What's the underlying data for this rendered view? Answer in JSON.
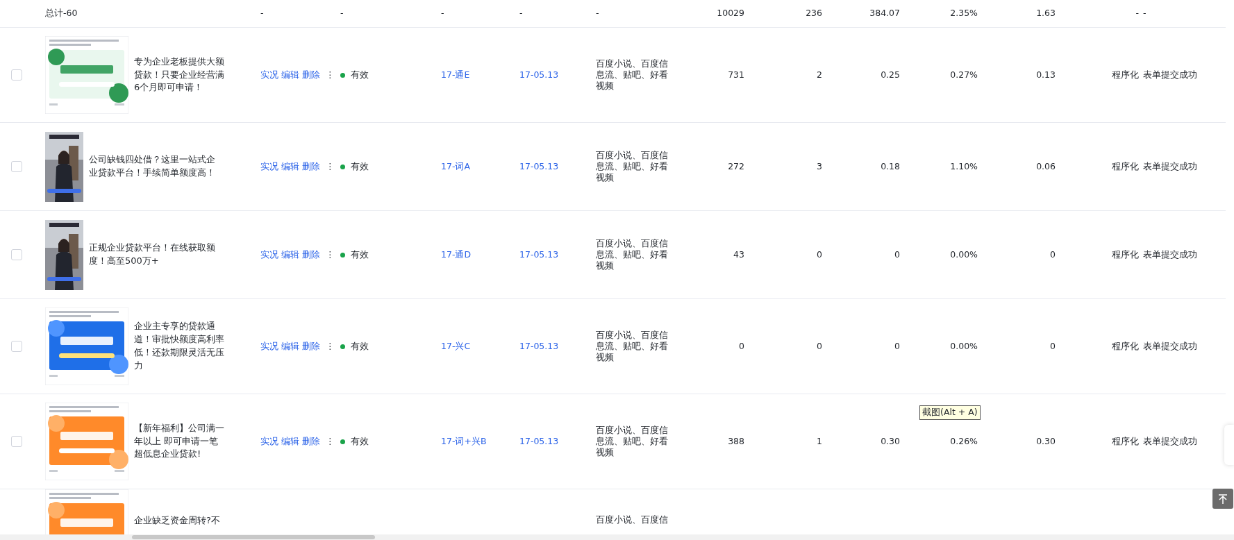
{
  "summary": {
    "label": "总计-60",
    "cells": [
      "-",
      "-",
      "-",
      "-",
      "-",
      "10029",
      "236",
      "384.07",
      "2.35%",
      "1.63",
      "-",
      "-"
    ]
  },
  "rows": [
    {
      "kind": "wide",
      "checked": false,
      "title": "专为企业老板提供大额贷款！只要企业经营满6个月即可申请！",
      "actions": [
        "实况",
        "编辑",
        "删除"
      ],
      "more": "⋮",
      "status": "有效",
      "color": "#1aa34a",
      "unit": "17-通E",
      "date": "17-05.13",
      "channels": "百度小说、百度信息流、贴吧、好看视频",
      "cells": [
        "731",
        "2",
        "0.25",
        "0.27%",
        "0.13",
        "程序化",
        "表单提交成功"
      ]
    },
    {
      "kind": "tall",
      "checked": false,
      "title": "公司缺钱四处借？这里一站式企业贷款平台！手续简单额度高！",
      "actions": [
        "实况",
        "编辑",
        "删除"
      ],
      "more": "⋮",
      "status": "有效",
      "color": "#1aa34a",
      "unit": "17-词A",
      "date": "17-05.13",
      "channels": "百度小说、百度信息流、贴吧、好看视频",
      "cells": [
        "272",
        "3",
        "0.18",
        "1.10%",
        "0.06",
        "程序化",
        "表单提交成功"
      ]
    },
    {
      "kind": "tall",
      "checked": false,
      "title": "正规企业贷款平台！在线获取额度！高至500万+",
      "actions": [
        "实况",
        "编辑",
        "删除"
      ],
      "more": "⋮",
      "status": "有效",
      "color": "#1aa34a",
      "unit": "17-通D",
      "date": "17-05.13",
      "channels": "百度小说、百度信息流、贴吧、好看视频",
      "cells": [
        "43",
        "0",
        "0",
        "0.00%",
        "0",
        "程序化",
        "表单提交成功"
      ]
    },
    {
      "kind": "wide",
      "checked": false,
      "title": "企业主专享的贷款通道！审批快额度高利率低！还款期限灵活无压力",
      "actions": [
        "实况",
        "编辑",
        "删除"
      ],
      "more": "⋮",
      "status": "有效",
      "color": "#1aa34a",
      "unit": "17-兴C",
      "date": "17-05.13",
      "channels": "百度小说、百度信息流、贴吧、好看视频",
      "cells": [
        "0",
        "0",
        "0",
        "0.00%",
        "0",
        "程序化",
        "表单提交成功"
      ]
    },
    {
      "kind": "wide",
      "checked": false,
      "title": "【新年福利】公司满一年以上 即可申请一笔超低息企业贷款!",
      "actions": [
        "实况",
        "编辑",
        "删除"
      ],
      "more": "⋮",
      "status": "有效",
      "color": "#1aa34a",
      "unit": "17-词+兴B",
      "date": "17-05.13",
      "channels": "百度小说、百度信息流、贴吧、好看视频",
      "cells": [
        "388",
        "1",
        "0.30",
        "0.26%",
        "0.30",
        "程序化",
        "表单提交成功"
      ]
    },
    {
      "kind": "cut",
      "title": "企业缺乏资金周转?不",
      "channels": "百度小说、百度信"
    }
  ],
  "tooltip": {
    "text": "截图(Alt + A)"
  }
}
